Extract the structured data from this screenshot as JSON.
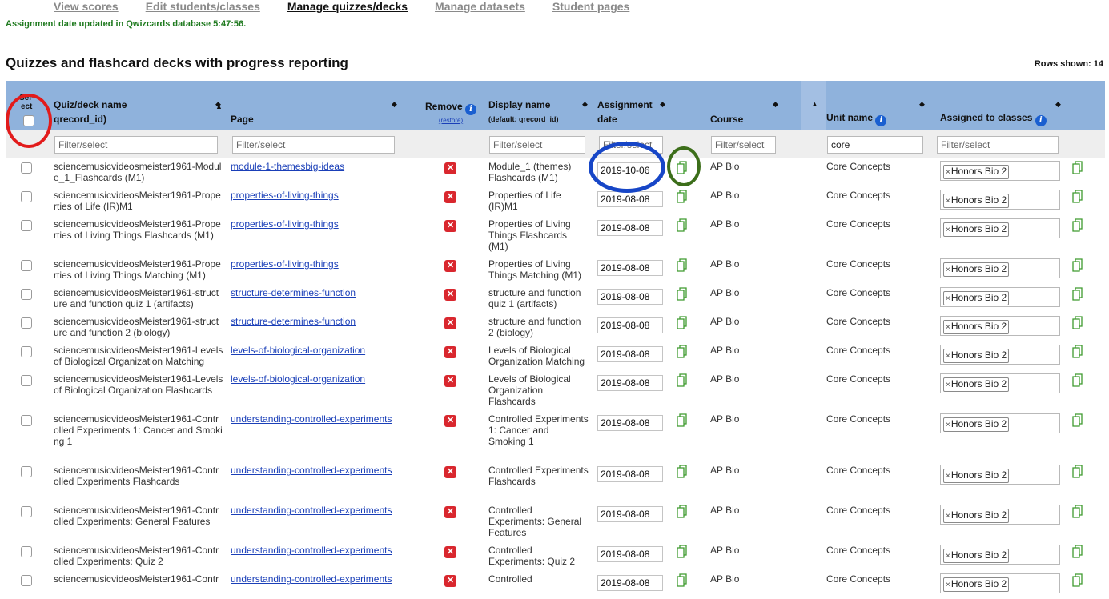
{
  "nav": [
    {
      "label": "View scores",
      "active": false
    },
    {
      "label": "Edit students/classes",
      "active": false
    },
    {
      "label": "Manage quizzes/decks",
      "active": true
    },
    {
      "label": "Manage datasets",
      "active": false
    },
    {
      "label": "Student pages",
      "active": false
    }
  ],
  "status_message": "Assignment date updated in Qwizcards database 5:47:56.",
  "heading": "Quizzes and flashcard decks with progress reporting",
  "rows_shown": "Rows shown: 14",
  "columns": {
    "select_line1": "Sel-",
    "select_line2": "ect",
    "quiz_line1": "Quiz/deck name",
    "quiz_line2": "qrecord_id)",
    "page": "Page",
    "remove": "Remove",
    "restore": "(restore)",
    "display_line1": "Display name",
    "display_line2": "(default: qrecord_id)",
    "assign_line1": "Assignment",
    "assign_line2": "date",
    "course": "Course",
    "unit": "Unit name",
    "classes": "Assigned to classes"
  },
  "filters": {
    "placeholder": "Filter/select",
    "unit_value": "core"
  },
  "icons": {
    "sort": "sort-arrows-icon",
    "info": "info-icon",
    "remove": "remove-x-icon",
    "copy": "copy-document-icon",
    "tag_remove": "tag-remove-x-icon"
  },
  "colors": {
    "header_bg": "#8fb2dc",
    "filter_bg": "#eeeeee",
    "status_green": "#1f7a1f",
    "link_blue": "#1a3fb8",
    "remove_red": "#d9272e",
    "copy_green": "#3e9a2e",
    "annotation_red": "#e21b1b",
    "annotation_blue": "#1746c7",
    "annotation_green": "#3c6e1a"
  },
  "rows": [
    {
      "quiz": "sciencemusicvideosmeister1961-Module_1_Flashcards (M1)",
      "page": "module-1-themesbig-ideas",
      "display": "Module_1 (themes) Flashcards (M1)",
      "date": "2019-10-06",
      "course": "AP Bio",
      "unit": "Core Concepts",
      "class": "Honors Bio 2"
    },
    {
      "quiz": "sciencemusicvideosMeister1961-Properties of Life (IR)M1",
      "page": "properties-of-living-things",
      "display": "Properties of Life (IR)M1",
      "date": "2019-08-08",
      "course": "AP Bio",
      "unit": "Core Concepts",
      "class": "Honors Bio 2"
    },
    {
      "quiz": "sciencemusicvideosMeister1961-Properties of Living Things Flashcards (M1)",
      "page": "properties-of-living-things",
      "display": "Properties of Living Things Flashcards (M1)",
      "date": "2019-08-08",
      "course": "AP Bio",
      "unit": "Core Concepts",
      "class": "Honors Bio 2"
    },
    {
      "quiz": "sciencemusicvideosMeister1961-Properties of Living Things Matching (M1)",
      "page": "properties-of-living-things",
      "display": "Properties of Living Things Matching (M1)",
      "date": "2019-08-08",
      "course": "AP Bio",
      "unit": "Core Concepts",
      "class": "Honors Bio 2"
    },
    {
      "quiz": "sciencemusicvideosMeister1961-structure and function quiz 1 (artifacts)",
      "page": "structure-determines-function",
      "display": "structure and function quiz 1 (artifacts)",
      "date": "2019-08-08",
      "course": "AP Bio",
      "unit": "Core Concepts",
      "class": "Honors Bio 2"
    },
    {
      "quiz": "sciencemusicvideosMeister1961-structure and function 2 (biology)",
      "page": "structure-determines-function",
      "display": "structure and function 2 (biology)",
      "date": "2019-08-08",
      "course": "AP Bio",
      "unit": "Core Concepts",
      "class": "Honors Bio 2"
    },
    {
      "quiz": "sciencemusicvideosMeister1961-Levels of Biological Organization Matching",
      "page": "levels-of-biological-organization",
      "display": "Levels of Biological Organization Matching",
      "date": "2019-08-08",
      "course": "AP Bio",
      "unit": "Core Concepts",
      "class": "Honors Bio 2"
    },
    {
      "quiz": "sciencemusicvideosMeister1961-Levels of Biological Organization Flashcards",
      "page": "levels-of-biological-organization",
      "display": "Levels of Biological Organization Flashcards",
      "date": "2019-08-08",
      "course": "AP Bio",
      "unit": "Core Concepts",
      "class": "Honors Bio 2"
    },
    {
      "quiz": "sciencemusicvideosMeister1961-Controlled Experiments 1: Cancer and Smoking 1",
      "page": "understanding-controlled-experiments",
      "display": "Controlled Experiments 1: Cancer and Smoking 1",
      "date": "2019-08-08",
      "course": "AP Bio",
      "unit": "Core Concepts",
      "class": "Honors Bio 2"
    },
    {
      "quiz": "sciencemusicvideosMeister1961-Controlled Experiments Flashcards",
      "page": "understanding-controlled-experiments",
      "display": "Controlled Experiments Flashcards",
      "date": "2019-08-08",
      "course": "AP Bio",
      "unit": "Core Concepts",
      "class": "Honors Bio 2"
    },
    {
      "quiz": "sciencemusicvideosMeister1961-Controlled Experiments: General Features",
      "page": "understanding-controlled-experiments",
      "display": "Controlled Experiments: General Features",
      "date": "2019-08-08",
      "course": "AP Bio",
      "unit": "Core Concepts",
      "class": "Honors Bio 2"
    },
    {
      "quiz": "sciencemusicvideosMeister1961-Controlled Experiments: Quiz 2",
      "page": "understanding-controlled-experiments",
      "display": "Controlled Experiments: Quiz 2",
      "date": "2019-08-08",
      "course": "AP Bio",
      "unit": "Core Concepts",
      "class": "Honors Bio 2"
    },
    {
      "quiz": "sciencemusicvideosMeister1961-Contr",
      "page": "understanding-controlled-experiments",
      "display": "Controlled",
      "date": "2019-08-08",
      "course": "AP Bio",
      "unit": "Core Concepts",
      "class": "Honors Bio 2"
    }
  ]
}
